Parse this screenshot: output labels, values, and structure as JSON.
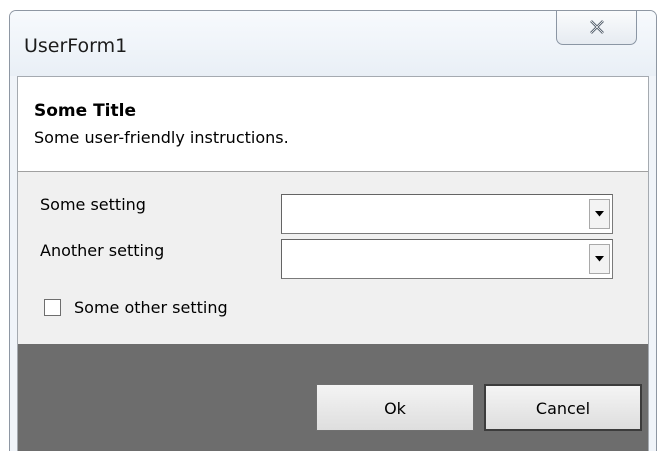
{
  "window": {
    "title": "UserForm1",
    "close_icon": "close-icon"
  },
  "header": {
    "title": "Some Title",
    "instructions": "Some user-friendly instructions."
  },
  "settings": {
    "setting1": {
      "label": "Some setting",
      "value": ""
    },
    "setting2": {
      "label": "Another setting",
      "value": ""
    },
    "checkbox": {
      "label": "Some other setting",
      "checked": false
    }
  },
  "buttons": {
    "ok_label": "Ok",
    "cancel_label": "Cancel"
  },
  "colors": {
    "button_panel_background": "#6d6d6d",
    "header_background": "#ffffff",
    "settings_background": "#f0f0f0"
  }
}
